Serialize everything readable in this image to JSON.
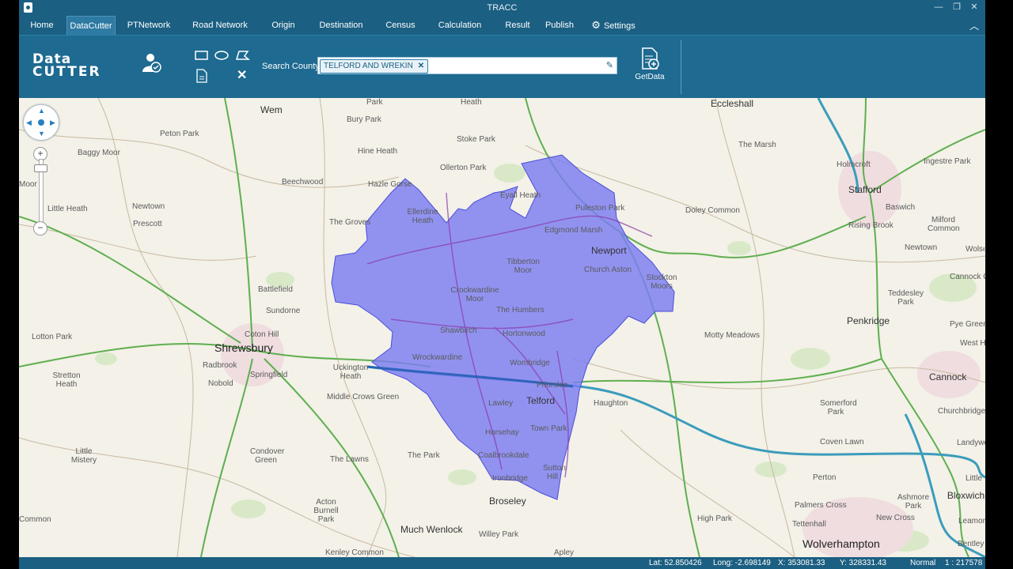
{
  "window": {
    "title": "TRACC"
  },
  "menu": {
    "tabs": [
      {
        "label": "Home"
      },
      {
        "label": "DataCutter"
      },
      {
        "label": "PTNetwork"
      },
      {
        "label": "Road Network"
      },
      {
        "label": "Origin"
      },
      {
        "label": "Destination"
      },
      {
        "label": "Census"
      },
      {
        "label": "Calculation"
      },
      {
        "label": "Result"
      },
      {
        "label": "Publish"
      },
      {
        "label": "Settings"
      }
    ],
    "active": "DataCutter"
  },
  "ribbon": {
    "brand_line1": "Data",
    "brand_line2": "CUTTER",
    "search_label": "Search County:",
    "search_chip": "TELFORD AND WREKIN",
    "getdata_label": "GetData"
  },
  "map": {
    "region_color": "#7b7cf2",
    "places": [
      {
        "name": "Wem"
      },
      {
        "name": "Eccleshall"
      },
      {
        "name": "Bury Park"
      },
      {
        "name": "Stoke Park"
      },
      {
        "name": "Peton Park"
      },
      {
        "name": "Baggy Moor"
      },
      {
        "name": "Hine Heath"
      },
      {
        "name": "Ollerton Park"
      },
      {
        "name": "The Marsh"
      },
      {
        "name": "Holmcroft"
      },
      {
        "name": "Ingestre Park"
      },
      {
        "name": "Beechwood"
      },
      {
        "name": "Hazle Gorse"
      },
      {
        "name": "Stafford"
      },
      {
        "name": "Eyall Heath"
      },
      {
        "name": "Ellerdine Heath"
      },
      {
        "name": "Puleston Park"
      },
      {
        "name": "Doley Common"
      },
      {
        "name": "Baswich"
      },
      {
        "name": "Little Heath"
      },
      {
        "name": "Newtown"
      },
      {
        "name": "Prescott"
      },
      {
        "name": "The Groves"
      },
      {
        "name": "Edgmond Marsh"
      },
      {
        "name": "Rising Brook"
      },
      {
        "name": "Milford Common"
      },
      {
        "name": "Tibberton Moor"
      },
      {
        "name": "Newport"
      },
      {
        "name": "Newtown"
      },
      {
        "name": "Wolseley"
      },
      {
        "name": "Church Aston"
      },
      {
        "name": "Battlefield"
      },
      {
        "name": "Stockton Moors"
      },
      {
        "name": "Cannock Chase"
      },
      {
        "name": "Crockwardine Moor"
      },
      {
        "name": "Sundorne"
      },
      {
        "name": "Teddesley Park"
      },
      {
        "name": "The Humbers"
      },
      {
        "name": "Penkridge"
      },
      {
        "name": "Pye Green"
      },
      {
        "name": "Shawbirch"
      },
      {
        "name": "Hortonwood"
      },
      {
        "name": "Lotton Park"
      },
      {
        "name": "Coton Hill"
      },
      {
        "name": "Motty Meadows"
      },
      {
        "name": "West Hill"
      },
      {
        "name": "Shrewsbury"
      },
      {
        "name": "Wrockwardine"
      },
      {
        "name": "Radbrook"
      },
      {
        "name": "Wombridge"
      },
      {
        "name": "Uckington Heath"
      },
      {
        "name": "Springfield"
      },
      {
        "name": "Stretton Heath"
      },
      {
        "name": "Cannock"
      },
      {
        "name": "Nobold"
      },
      {
        "name": "Priorslee"
      },
      {
        "name": "Middle Crows Green"
      },
      {
        "name": "Haughton"
      },
      {
        "name": "Lawley"
      },
      {
        "name": "Telford"
      },
      {
        "name": "Somerford Park"
      },
      {
        "name": "Churchbridge"
      },
      {
        "name": "Horsehay"
      },
      {
        "name": "Town Park"
      },
      {
        "name": "Coven Lawn"
      },
      {
        "name": "Landywood"
      },
      {
        "name": "Condover Green"
      },
      {
        "name": "Little Mistery"
      },
      {
        "name": "The Park"
      },
      {
        "name": "Coalbrookdale"
      },
      {
        "name": "The Lawns"
      },
      {
        "name": "Sutton Hill"
      },
      {
        "name": "Ironbridge"
      },
      {
        "name": "Perton"
      },
      {
        "name": "Little Wyrley"
      },
      {
        "name": "Broseley"
      },
      {
        "name": "Ashmore Park"
      },
      {
        "name": "Bloxwich"
      },
      {
        "name": "Acton Burnell Park"
      },
      {
        "name": "Palmers Cross"
      },
      {
        "name": "New Cross"
      },
      {
        "name": "High Park"
      },
      {
        "name": "Much Wenlock"
      },
      {
        "name": "Tettenhall"
      },
      {
        "name": "Leamore"
      },
      {
        "name": "Willey Park"
      },
      {
        "name": "Kenley Common"
      },
      {
        "name": "Apley"
      },
      {
        "name": "Wolverhampton"
      },
      {
        "name": "Bentley"
      },
      {
        "name": "Heath"
      },
      {
        "name": "Park"
      },
      {
        "name": "Common"
      },
      {
        "name": "Moor"
      }
    ]
  },
  "status": {
    "lat": "Lat: 52.850426",
    "long": "Long: -2.698149",
    "x": "X: 353081.33",
    "y": "Y: 328331.43",
    "mode": "Normal",
    "scale": "1 : 217578"
  }
}
